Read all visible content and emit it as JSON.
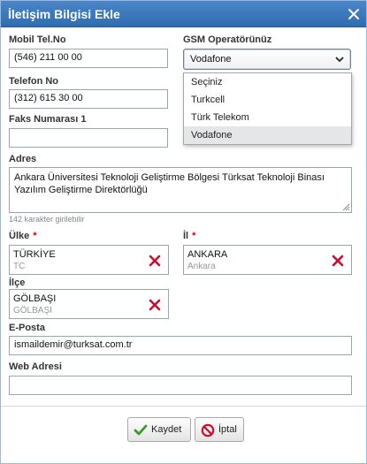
{
  "dialog": {
    "title": "İletişim Bilgisi Ekle"
  },
  "form": {
    "mobile": {
      "label": "Mobil Tel.No",
      "value": "(546) 211 00 00"
    },
    "gsm": {
      "label": "GSM Operatörünüz",
      "value": "Vodafone",
      "options": [
        "Seçiniz",
        "Turkcell",
        "Türk Telekom",
        "Vodafone"
      ],
      "selected_index": 3
    },
    "phone": {
      "label": "Telefon No",
      "value": "(312) 615 30 00"
    },
    "fax": {
      "label": "Faks Numarası 1",
      "value": ""
    },
    "address": {
      "label": "Adres",
      "line1": "Ankara Üniversitesi Teknoloji Geliştirme Bölgesi Türksat Teknoloji Binası",
      "line2": "Yazılım Geliştirme Direktörlüğü",
      "hint": "142 karakter girilebilir"
    },
    "country": {
      "label": "Ülke",
      "required_mark": "*",
      "value": "TÜRKİYE",
      "code": "TC"
    },
    "province": {
      "label": "İl",
      "required_mark": "*",
      "value": "ANKARA",
      "sub": "Ankara"
    },
    "district": {
      "label": "İlçe",
      "value": "GÖLBAŞI",
      "sub": "GÖLBAŞI"
    },
    "email": {
      "label": "E-Posta",
      "value": "ismaildemir@turksat.com.tr"
    },
    "web": {
      "label": "Web Adresi",
      "value": ""
    }
  },
  "buttons": {
    "save": "Kaydet",
    "cancel": "İptal"
  },
  "icons": {
    "close": "close-icon",
    "chevron": "chevron-down-icon",
    "clear": "red-x-icon",
    "save": "checkmark-icon",
    "cancel": "no-entry-icon"
  },
  "colors": {
    "title_bar": "#3a78bd",
    "required": "#d40000",
    "clear_icon": "#c8102e",
    "save_check": "#3c9a2c"
  }
}
